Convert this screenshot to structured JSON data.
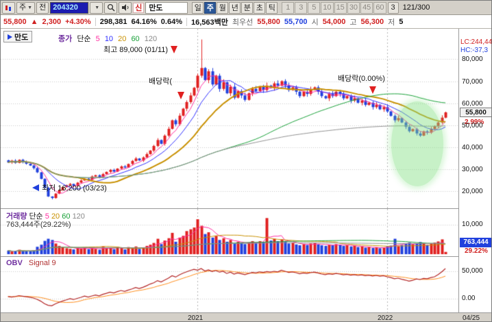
{
  "toolbar": {
    "period_selector": "주",
    "prev_label": "전",
    "stock_code": "204320",
    "flag": "신",
    "stock_name": "만도",
    "periods": [
      "일",
      "주",
      "월",
      "년",
      "분",
      "초",
      "틱"
    ],
    "minutes": [
      "1",
      "3",
      "5",
      "10",
      "15",
      "30",
      "45",
      "60"
    ],
    "tick_value": "3",
    "bar_counter": "121/300"
  },
  "quote": {
    "price": "55,800",
    "arrow": "▲",
    "change": "2,300",
    "change_pct": "+4.30%",
    "volume": "298,381",
    "ratio1": "64.16%",
    "ratio2": "0.64%",
    "amount": "16,563백만",
    "best_label": "최우선",
    "best_ask": "55,800",
    "best_bid": "55,700",
    "open_label": "시",
    "open": "54,000",
    "high_label": "고",
    "high": "56,300",
    "low_label": "저",
    "low": "5"
  },
  "price_panel": {
    "tab_label": "만도",
    "legend_name": "종가",
    "legend_type": "단순",
    "ma_periods": [
      "5",
      "10",
      "20",
      "60",
      "120"
    ],
    "annot_high": "최고 89,000 (01/11)",
    "annot_low": "최저 16,200 (03/23)",
    "annot_exdiv1": "배당락(",
    "annot_exdiv2": "배당락(0.00%)",
    "lc": "LC:244,44",
    "hc": "HC:-37,3",
    "axis_values": [
      80000,
      70000,
      60000,
      50000,
      40000,
      30000,
      20000
    ],
    "axis_labels": [
      "80,000",
      "70,000",
      "60,000",
      "50,000",
      "40,000",
      "30,000",
      "20,000"
    ],
    "current_price": "55,800",
    "current_pct": "2.99%"
  },
  "volume_panel": {
    "legend_name": "거래량",
    "legend_type": "단순",
    "ma_periods": [
      "5",
      "20",
      "60",
      "120"
    ],
    "current_text": "763,444주(29.22%)",
    "axis_label": "10,000",
    "axis_value": 10000,
    "current_value": "763,444",
    "current_pct": "29.22%"
  },
  "obv_panel": {
    "legend_name": "OBV",
    "legend_signal": "Signal 9",
    "axis_labels": [
      "50,000",
      "0.00"
    ],
    "axis_values": [
      50000,
      0
    ]
  },
  "timeline": {
    "y2021": "2021",
    "y2022": "2022",
    "end": "04/25"
  },
  "colors": {
    "up": "#e02020",
    "down": "#2040dd",
    "ma5": "#ff2da0",
    "ma10": "#2d2dff",
    "ma20": "#c89000",
    "ma60": "#18a038",
    "ma120": "#909090",
    "obv": "#b22222",
    "obv_signal": "#ff8c1a",
    "grid": "#c8c8c8",
    "year_line": "#b0b0b0",
    "code_bg": "#1b1bb0",
    "vol_box_bg": "#2040dd",
    "highlight": "rgba(130,225,130,0.45)"
  },
  "chart_data": {
    "type": "candlestick+volume+obv",
    "period": "weekly",
    "count": 121,
    "first_open": 34000,
    "last_price": 55800,
    "price_range": [
      14000,
      92000
    ],
    "volume_range": [
      0,
      12500
    ],
    "obv_range": [
      -15000,
      60000
    ],
    "year_break_indices": [
      52,
      104
    ],
    "ma_periods_price": [
      5,
      10,
      20,
      60,
      120
    ],
    "ma_periods_volume": [
      5,
      20,
      60,
      120
    ],
    "obv_signal_period": 9,
    "wick_high_override": {
      "53": 89000
    },
    "wick_low_override": {
      "12": 16200
    },
    "closes": [
      33000,
      33800,
      32800,
      34200,
      33200,
      32400,
      31600,
      30400,
      28500,
      25500,
      21500,
      17500,
      16800,
      18800,
      20300,
      21800,
      22600,
      23200,
      22300,
      23800,
      24800,
      25600,
      25100,
      26600,
      27200,
      26300,
      27700,
      28700,
      29600,
      28800,
      30200,
      31200,
      30700,
      32300,
      33700,
      34800,
      33900,
      35300,
      36800,
      38400,
      40500,
      43200,
      41500,
      45200,
      48300,
      52200,
      50400,
      54300,
      57500,
      60500,
      63500,
      67000,
      72500,
      76000,
      70500,
      74500,
      68500,
      72500,
      66500,
      69500,
      64500,
      67500,
      62500,
      65500,
      63500,
      61500,
      64500,
      66500,
      65500,
      67500,
      66000,
      68000,
      67000,
      69000,
      68000,
      70000,
      68000,
      66000,
      67200,
      65200,
      63200,
      65200,
      64200,
      66200,
      67200,
      65200,
      63200,
      62200,
      64200,
      63200,
      65200,
      64200,
      62200,
      63200,
      61200,
      62200,
      60200,
      61200,
      59200,
      60200,
      58200,
      59200,
      57200,
      58200,
      56200,
      54200,
      52200,
      53200,
      51200,
      49200,
      47200,
      48200,
      46200,
      45200,
      47200,
      46600,
      48200,
      49600,
      51200,
      53400,
      55800
    ],
    "volumes": [
      1200,
      900,
      1000,
      1500,
      1100,
      950,
      1000,
      1300,
      2500,
      3200,
      4500,
      5200,
      4800,
      3600,
      2800,
      2400,
      2000,
      1800,
      1600,
      2100,
      1900,
      2200,
      1700,
      2000,
      1800,
      1500,
      2600,
      1900,
      2300,
      1700,
      2500,
      2100,
      1600,
      2400,
      2000,
      2600,
      1800,
      2200,
      2800,
      3200,
      3800,
      5200,
      3400,
      4600,
      5400,
      7200,
      4200,
      5600,
      6200,
      7800,
      8400,
      9000,
      11800,
      9600,
      6800,
      7400,
      5600,
      6200,
      4800,
      5400,
      4200,
      4800,
      3600,
      4200,
      3800,
      3400,
      4000,
      4400,
      3800,
      4400,
      4000,
      12200,
      4600,
      5200,
      4400,
      5000,
      4200,
      3600,
      3900,
      3300,
      3000,
      3400,
      3100,
      3600,
      3800,
      3300,
      3000,
      2800,
      3200,
      3000,
      3400,
      3200,
      2800,
      3000,
      2600,
      2800,
      2400,
      2600,
      2200,
      2400,
      2100,
      2300,
      2000,
      2200,
      2600,
      2900,
      5200,
      2700,
      3100,
      3500,
      3900,
      3300,
      3700,
      4100,
      3500,
      3100,
      3600,
      3900,
      4300,
      5000,
      763
    ],
    "obv": [
      4000,
      3100,
      4100,
      5600,
      4500,
      3550,
      2550,
      1250,
      -1300,
      -4500,
      -9000,
      -12000,
      -13000,
      -9400,
      -6600,
      -4200,
      -2200,
      100,
      -1500,
      600,
      2500,
      4700,
      3000,
      5000,
      6800,
      5300,
      7900,
      9800,
      12100,
      10400,
      12900,
      15000,
      13400,
      15800,
      17800,
      20400,
      18600,
      20800,
      23600,
      26800,
      29000,
      33000,
      30500,
      34000,
      37500,
      42000,
      39500,
      43500,
      46500,
      49000,
      51500,
      53500,
      52000,
      55000,
      50500,
      52500,
      49500,
      51500,
      48500,
      50000,
      46000,
      48500,
      45000,
      47000,
      45500,
      44000,
      46000,
      48000,
      47000,
      49000,
      48000,
      49500,
      48500,
      50000,
      49000,
      52000,
      50000,
      48000,
      49000,
      47500,
      45500,
      47000,
      46000,
      47500,
      48500,
      47000,
      45000,
      44000,
      45500,
      44500,
      46000,
      45000,
      43500,
      44500,
      43000,
      44000,
      42500,
      43500,
      42000,
      43000,
      41500,
      42500,
      41000,
      42000,
      40000,
      38500,
      36500,
      37500,
      35500,
      34000,
      32000,
      33500,
      36000,
      35000,
      37000,
      36500,
      38500,
      40000,
      44000,
      49000,
      55000
    ]
  }
}
